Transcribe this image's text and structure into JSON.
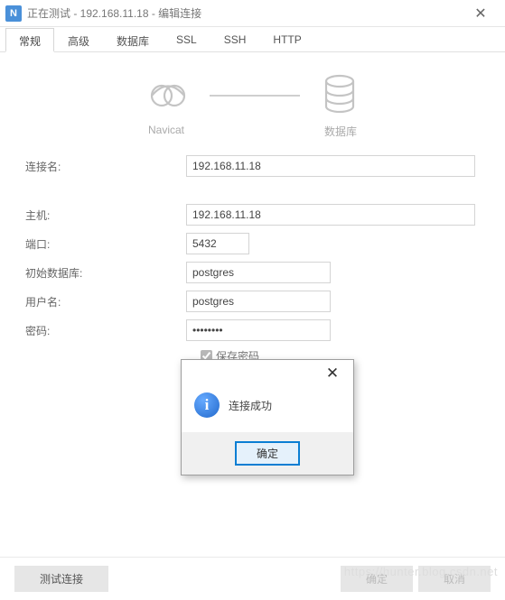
{
  "titlebar": {
    "app_icon_glyph": "N",
    "title": "正在测试 - 192.168.11.18 - 编辑连接"
  },
  "tabs": [
    "常规",
    "高级",
    "数据库",
    "SSL",
    "SSH",
    "HTTP"
  ],
  "active_tab_index": 0,
  "diagram": {
    "left_label": "Navicat",
    "right_label": "数据库"
  },
  "form": {
    "connection_name": {
      "label": "连接名:",
      "value": "192.168.11.18"
    },
    "host": {
      "label": "主机:",
      "value": "192.168.11.18"
    },
    "port": {
      "label": "端口:",
      "value": "5432"
    },
    "initial_db": {
      "label": "初始数据库:",
      "value": "postgres"
    },
    "user": {
      "label": "用户名:",
      "value": "postgres"
    },
    "password": {
      "label": "密码:",
      "value": "••••••••"
    },
    "save_password": {
      "label": "保存密码",
      "checked": true
    }
  },
  "msgbox": {
    "text": "连接成功",
    "ok": "确定"
  },
  "footer": {
    "test": "测试连接",
    "ok": "确定",
    "cancel": "取消"
  },
  "watermark": "https://hunter.blog.csdn.net"
}
